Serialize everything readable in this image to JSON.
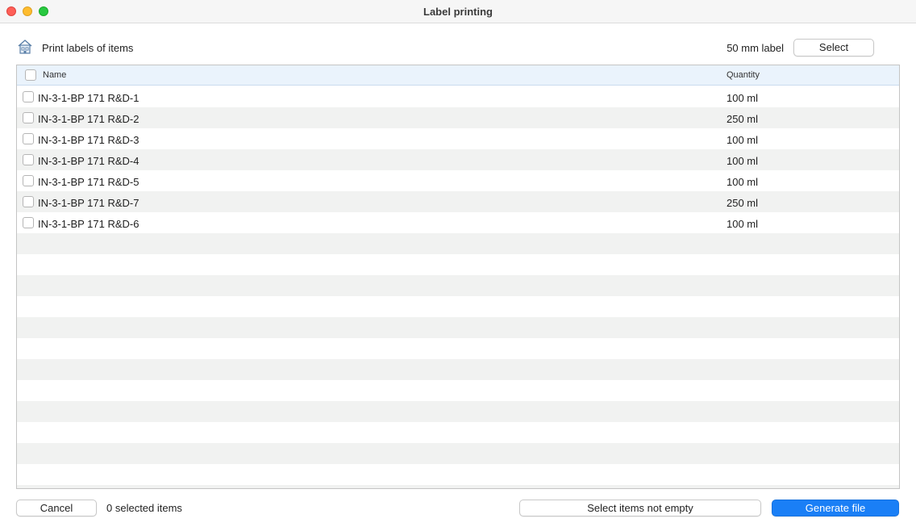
{
  "window": {
    "title": "Label printing"
  },
  "header": {
    "icon": "house-labels-icon",
    "title": "Print labels of items",
    "label_size": "50 mm label",
    "select_label": "Select"
  },
  "table": {
    "columns": {
      "name": "Name",
      "quantity": "Quantity"
    },
    "rows": [
      {
        "name": "IN-3-1-BP 171 R&D-1",
        "quantity": "100 ml"
      },
      {
        "name": "IN-3-1-BP 171 R&D-2",
        "quantity": "250 ml"
      },
      {
        "name": "IN-3-1-BP 171 R&D-3",
        "quantity": "100 ml"
      },
      {
        "name": "IN-3-1-BP 171 R&D-4",
        "quantity": "100 ml"
      },
      {
        "name": "IN-3-1-BP 171 R&D-5",
        "quantity": "100 ml"
      },
      {
        "name": "IN-3-1-BP 171 R&D-7",
        "quantity": "250 ml"
      },
      {
        "name": "IN-3-1-BP 171 R&D-6",
        "quantity": "100 ml"
      }
    ]
  },
  "footer": {
    "cancel_label": "Cancel",
    "selected_count": "0 selected items",
    "select_not_empty_label": "Select items not empty",
    "generate_label": "Generate file"
  },
  "colors": {
    "accent": "#1a7ff6",
    "header_bg": "#eaf3fc",
    "stripe": "#f1f2f1"
  }
}
